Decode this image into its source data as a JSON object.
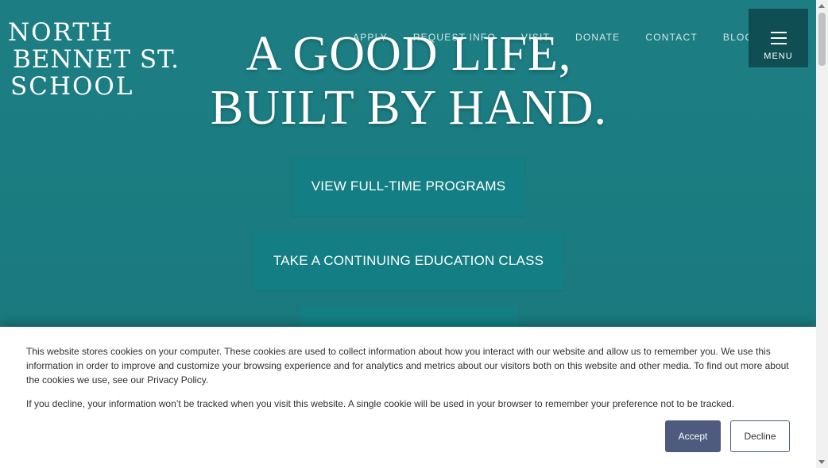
{
  "brand": {
    "line1": "NORTH",
    "line2": "BENNET ST.",
    "line3": "SCHOOL"
  },
  "nav": {
    "items": [
      "APPLY",
      "REQUEST INFO",
      "VISIT",
      "DONATE",
      "CONTACT",
      "BLOG"
    ],
    "menu_label": "MENU"
  },
  "hero": {
    "line1": "A GOOD LIFE,",
    "line2": "BUILT BY HAND."
  },
  "cta": {
    "programs": "VIEW FULL-TIME PROGRAMS",
    "continuing_ed": "TAKE A CONTINUING EDUCATION CLASS",
    "third": ""
  },
  "cookie": {
    "text1": "This website stores cookies on your computer. These cookies are used to collect information about how you interact with our website and allow us to remember you. We use this information in order to improve and customize your browsing experience and for analytics and metrics about our visitors both on this website and other media. To find out more about the cookies we use, see our Privacy Policy.",
    "text2": "If you decline, your information won’t be tracked when you visit this website. A single cookie will be used in your browser to remember your preference not to be tracked.",
    "accept": "Accept",
    "decline": "Decline"
  },
  "colors": {
    "background": "#1b7b80",
    "menu_button": "#0f4e53",
    "cta_button": "#137f84",
    "accept_button": "#4e5b7e"
  },
  "icons": {
    "menu": "hamburger-icon"
  }
}
